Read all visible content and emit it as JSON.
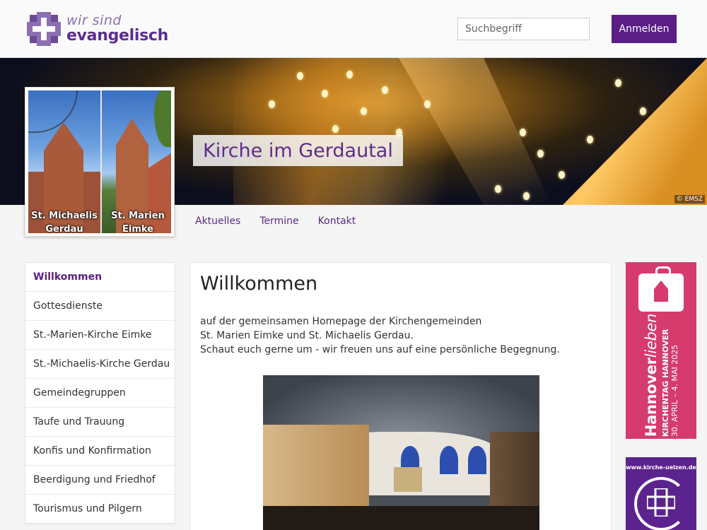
{
  "header": {
    "logo_small": "wir sind",
    "logo_big": "evangelisch",
    "search_placeholder": "Suchbegriff",
    "login_label": "Anmelden"
  },
  "banner": {
    "title": "Kirche im Gerdautal",
    "copyright": "© EMSZ"
  },
  "photo": {
    "label_left_1": "St. Michaelis",
    "label_left_2": "Gerdau",
    "label_right_1": "St. Marien",
    "label_right_2": "Eimke"
  },
  "topnav": [
    "Aktuelles",
    "Termine",
    "Kontakt"
  ],
  "sidebar": {
    "items": [
      "Willkommen",
      "Gottesdienste",
      "St.-Marien-Kirche Eimke",
      "St.-Michaelis-Kirche Gerdau",
      "Gemeindegruppen",
      "Taufe und Trauung",
      "Konfis und Konfirmation",
      "Beerdigung und Friedhof",
      "Tourismus und Pilgern"
    ]
  },
  "main": {
    "heading": "Willkommen",
    "line1": "auf der gemeinsamen Homepage der Kirchengemeinden",
    "line2": "St. Marien Eimke und St. Michaelis Gerdau.",
    "line3": "Schaut euch gerne um - wir freuen uns auf eine persönliche Begegnung."
  },
  "ads": {
    "kirchentag_big_1": "Hannover",
    "kirchentag_big_2": "lieben",
    "kirchentag_line1": "KIRCHENTAG HANNOVER",
    "kirchentag_line2": "30. APRIL – 4. MAI 2025",
    "uelzen_url": "www.kirche-uelzen.de"
  },
  "colors": {
    "brand_purple": "#5a1e86",
    "kirchentag_pink": "#d63b6e"
  }
}
